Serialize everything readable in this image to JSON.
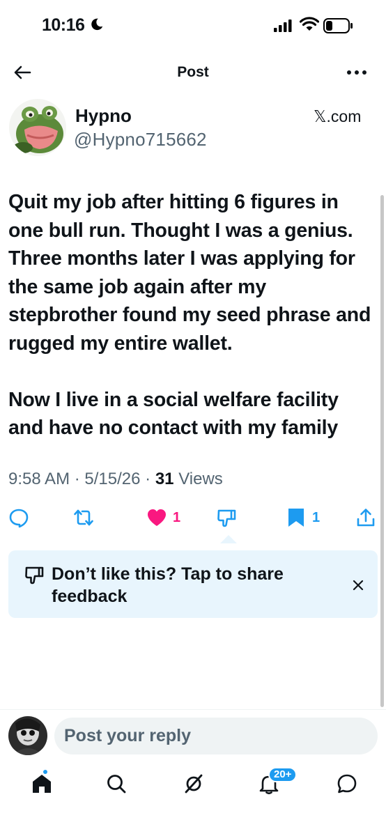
{
  "status_bar": {
    "time": "10:16",
    "icons": [
      "moon-icon",
      "cellular-signal-icon",
      "wifi-icon",
      "battery-icon"
    ]
  },
  "header": {
    "title": "Post",
    "back_icon": "arrow-left-icon",
    "more_icon": "more-dots-icon"
  },
  "author": {
    "display_name": "Hypno",
    "handle": "@Hypno715662",
    "source": "𝕏.com"
  },
  "post": {
    "text": "Quit my job after hitting 6 figures in one bull run. Thought I was a genius. Three months later I was applying for the same job again after my stepbrother found my seed phrase and rugged my entire wallet.\n\nNow I live in a social welfare facility and have no contact with my family",
    "time": "9:58 AM",
    "date": "5/15/26",
    "separator": "·",
    "views_count": "31",
    "views_label": "Views"
  },
  "actions": {
    "reply_count": "",
    "repost_count": "",
    "like_count": "1",
    "bookmark_count": "1"
  },
  "feedback": {
    "text": "Don’t like this? Tap to share feedback"
  },
  "reply": {
    "placeholder": "Post your reply"
  },
  "tab_bar": {
    "notifications_badge": "20+"
  },
  "colors": {
    "accent": "#1d9bf0",
    "like": "#f91880",
    "text": "#0f1419",
    "secondary_text": "#536471",
    "feedback_bg": "#e8f5fd"
  }
}
